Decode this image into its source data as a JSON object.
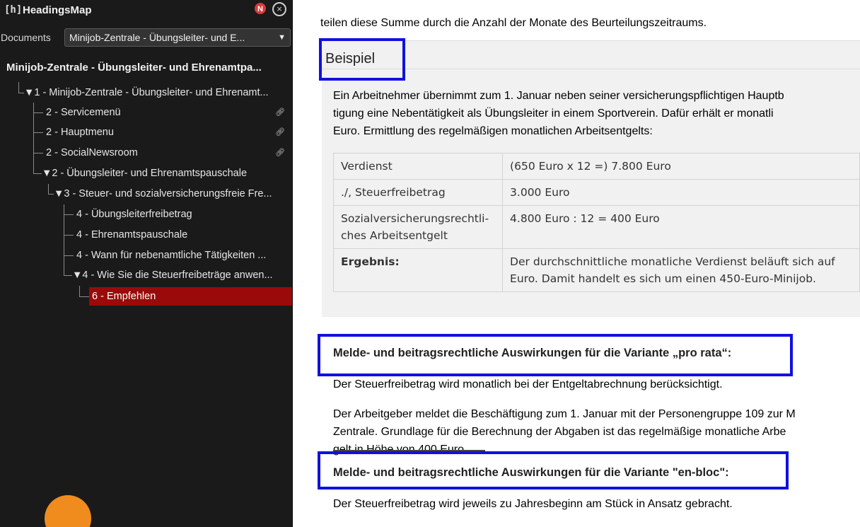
{
  "sidebar": {
    "logo": "[h]",
    "title": "HeadingsMap",
    "warning_badge": "N",
    "close_glyph": "×",
    "documents_label": "Documents",
    "documents_select": "Minijob-Zentrale - Übungsleiter- und E...",
    "doc_heading": "Minijob-Zentrale - Übungsleiter- und Ehrenamtpa...",
    "tree": [
      {
        "text": "▼1 -  Minijob-Zentrale - Übungsleiter- und Ehrenamt...",
        "link": false
      },
      {
        "text": "2 - Servicemenü",
        "link": true
      },
      {
        "text": "2 - Hauptmenu",
        "link": true
      },
      {
        "text": "2 - SocialNewsroom",
        "link": true
      },
      {
        "text": "▼2 -  Übungsleiter- und Ehrenamtspauschale",
        "link": false
      },
      {
        "text": "▼3 - Steuer- und sozialversicherungsfreie Fre...",
        "link": false
      },
      {
        "text": "4 - Übungsleiterfreibetrag",
        "link": false
      },
      {
        "text": "4 - Ehrenamtspauschale",
        "link": false
      },
      {
        "text": "4 - Wann für nebenamtliche Tätigkeiten ...",
        "link": false
      },
      {
        "text": "▼4 - Wie Sie die Steuerfreibeträge anwen...",
        "link": false
      },
      {
        "text": "6 - Empfehlen",
        "link": false,
        "active": true
      }
    ],
    "colors": {
      "background": "#1a1a1a",
      "active": "#9a0a0a",
      "badge": "#f08c1e"
    }
  },
  "content": {
    "intro": "teilen diese Summe durch die Anzahl der Monate des Beurteilungszeitraums.",
    "box_title": "Beispiel",
    "box_lines": [
      "Ein Arbeitnehmer übernimmt zum 1. Januar neben seiner versicherungspflichtigen Hauptb",
      "tigung eine Nebentätigkeit als Übungsleiter in einem Sportverein. Dafür erhält er monatli",
      "Euro. Ermittlung des regelmäßigen monatlichen Arbeitsentgelts:"
    ],
    "table": [
      [
        "Verdienst",
        "(650 Euro x 12 =) 7.800 Euro"
      ],
      [
        "./, Steuerfreibetrag",
        "3.000 Euro"
      ],
      [
        "Sozialversicherungsrechtli-\nches Arbeitsentgelt",
        "4.800 Euro : 12 = 400 Euro"
      ],
      [
        "Ergebnis:",
        "Der durchschnittliche monatliche Verdienst beläuft sich auf\nEuro. Damit handelt es sich um einen 450-Euro-Minijob."
      ]
    ],
    "subhead1": "Melde- und beitragsrechtliche Auswirkungen für die Variante „pro rata“:",
    "para1": "Der Steuerfreibetrag wird monatlich bei der Entgeltabrechnung berücksichtigt.",
    "para2_lines": [
      "Der Arbeitgeber meldet die Beschäftigung zum 1. Januar mit der Personengruppe 109 zur M",
      "Zentrale. Grundlage für die Berechnung der Abgaben ist das regelmäßige monatliche Arbe",
      "gelt in Höhe von 400 Euro."
    ],
    "subhead2": "Melde- und beitragsrechtliche Auswirkungen für die Variante \"en-bloc\":",
    "para3": "Der Steuerfreibetrag wird jeweils zu Jahresbeginn am Stück in Ansatz gebracht.",
    "highlight_color": "#1010e0"
  }
}
